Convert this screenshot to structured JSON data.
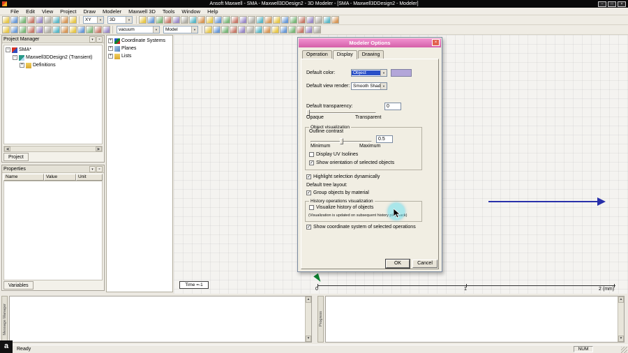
{
  "window": {
    "title": "Ansoft Maxwell  - SMA - Maxwell3DDesign2 - 3D Modeler - [SMA - Maxwell3DDesign2 - Modeler]"
  },
  "icons": {
    "minimize": "–",
    "maximize": "□",
    "close": "×",
    "pin": "▾",
    "dropdown": "▼",
    "check": "✓",
    "expand": "+",
    "collapse": "−",
    "scroll_up": "▲",
    "scroll_down": "▼",
    "scroll_left": "◀",
    "scroll_right": "▶"
  },
  "menu": {
    "items": [
      "File",
      "Edit",
      "View",
      "Project",
      "Draw",
      "Modeler",
      "Maxwell 3D",
      "Tools",
      "Window",
      "Help"
    ]
  },
  "toolbar": {
    "plane_combo": "XY",
    "view_combo": "3D",
    "material_combo": "vacuum",
    "model_combo": "Model",
    "row1a_icons": [
      "new",
      "open",
      "save",
      "print",
      "cut",
      "copy",
      "paste",
      "undo",
      "redo"
    ],
    "row1b_icons": [
      "pan",
      "rotate-view",
      "zoom-in",
      "zoom-out",
      "zoom-window",
      "fit-all",
      "fit-selection",
      "orient-top",
      "orient-front",
      "orient-side",
      "orient-iso",
      "draw-line",
      "draw-spline",
      "draw-arc",
      "draw-rectangle",
      "draw-ellipse",
      "draw-circle",
      "draw-polygon",
      "draw-box",
      "draw-cylinder",
      "draw-sphere",
      "draw-torus",
      "draw-helix",
      "measure"
    ],
    "row2a_icons": [
      "select-object",
      "select-face",
      "select-edge",
      "select-vertex",
      "move",
      "rotate-model",
      "grid-settings",
      "snap-settings",
      "coordinate-system",
      "relative-cs",
      "face-cs",
      "object-cs",
      "history"
    ],
    "row2b_icons": [
      "boolean-unite",
      "boolean-subtract",
      "boolean-intersect",
      "split",
      "duplicate-mirror",
      "duplicate-along-line",
      "duplicate-around-axis",
      "sweep-along-vector",
      "sweep-around-axis",
      "thicken-sheet",
      "section",
      "validate",
      "analyze",
      "mesh-plot"
    ]
  },
  "project_manager": {
    "title": "Project Manager",
    "items": [
      "SMA*",
      "Maxwell3DDesign2 (Transient)",
      "Definitions"
    ],
    "tab": "Project"
  },
  "properties": {
    "title": "Properties",
    "columns": [
      "Name",
      "Value",
      "Unit"
    ],
    "tab": "Variables"
  },
  "model_tree": {
    "items": [
      "Coordinate Systems",
      "Planes",
      "Lists"
    ]
  },
  "dialog": {
    "title": "Modeler Options",
    "tabs": [
      "Operation",
      "Display",
      "Drawing"
    ],
    "active_tab": "Display",
    "default_color_label": "Default color:",
    "default_color_value": "Object",
    "default_view_render_label": "Default view render:",
    "default_view_render_value": "Smooth Shade",
    "default_transparency_label": "Default transparency:",
    "transparency_value": "0",
    "opaque_label": "Opaque",
    "transparent_label": "Transparent",
    "object_visualization_group": "Object visualization",
    "outline_contrast_label": "Outline contrast",
    "outline_contrast_value": "0.5",
    "minimum_label": "Minimum",
    "maximum_label": "Maximum",
    "display_uv_isolines": "Display UV Isolines",
    "show_orientation": "Show orientation of selected objects",
    "highlight_selection": "Highlight selection dynamically",
    "default_tree_layout_label": "Default tree layout:",
    "group_objects": "Group objects by material",
    "history_group": "History operations visualization",
    "visualize_history": "Visualize history of objects",
    "history_note": "(Visualization is updated on subsequent history play back)",
    "show_coordinate_system": "Show coordinate system of selected operations",
    "ok": "OK",
    "cancel": "Cancel"
  },
  "canvas": {
    "time_label": "Time =-1",
    "ruler_ticks": [
      "0",
      "1",
      "2 (mm)"
    ]
  },
  "docks": {
    "message_manager": "Message Manager",
    "progress": "Progress"
  },
  "status_bar": {
    "ready": "Ready",
    "num": "NUM"
  },
  "watermark": "a",
  "colors": {
    "dialog_titlebar": "#d45fa8",
    "selection_blue": "#2a50c8",
    "default_color_swatch": "#b3a6d9",
    "axis_arrow": "#2830aa",
    "origin_marker": "#0c8030",
    "cursor_highlight": "#6ee1f0"
  }
}
